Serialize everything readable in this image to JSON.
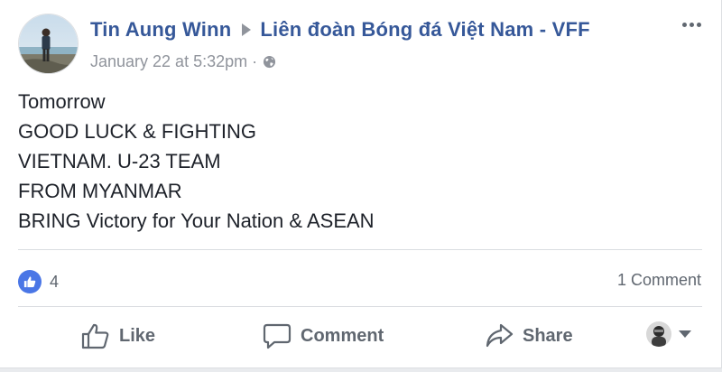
{
  "post": {
    "author": "Tin Aung Winn",
    "target": "Liên đoàn Bóng đá Việt Nam - VFF",
    "timestamp": "January 22 at 5:32pm",
    "meta_separator": "·",
    "privacy_icon": "globe-icon",
    "body_lines": [
      "Tomorrow",
      "GOOD LUCK & FIGHTING",
      "VIETNAM. U-23 TEAM",
      "FROM MYANMAR",
      "BRING Victory for Your Nation & ASEAN"
    ]
  },
  "reactions": {
    "icon": "thumbs-up-icon",
    "count": "4",
    "comments": "1 Comment"
  },
  "actions": {
    "like": "Like",
    "comment": "Comment",
    "share": "Share"
  },
  "colors": {
    "link": "#365899",
    "muted": "#90949c",
    "like_badge": "#4a76e6",
    "text": "#1d2129"
  }
}
